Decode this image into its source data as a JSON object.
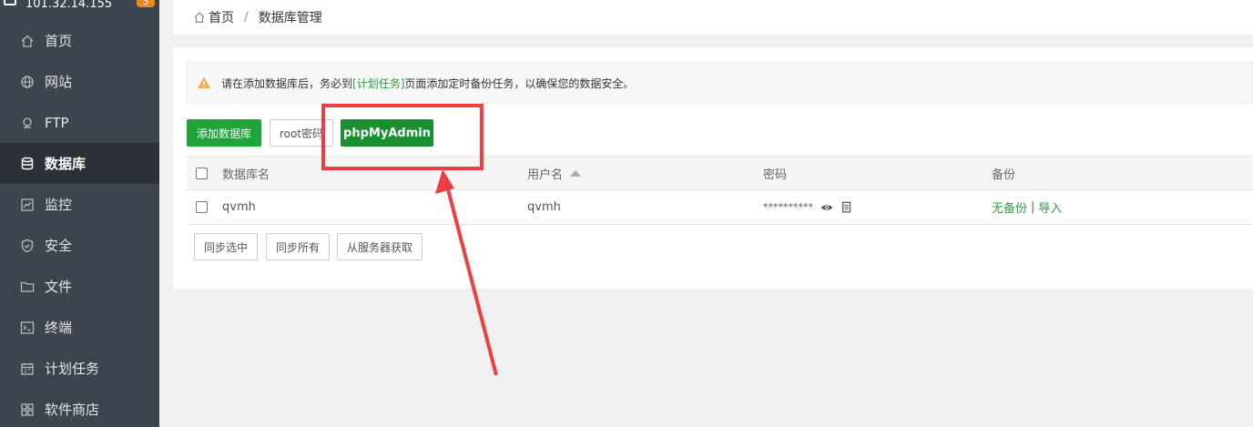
{
  "sidebar": {
    "ip": "101.32.14.155",
    "badge": "3",
    "items": [
      {
        "label": "首页",
        "icon": "home-icon"
      },
      {
        "label": "网站",
        "icon": "globe-icon"
      },
      {
        "label": "FTP",
        "icon": "ftp-icon"
      },
      {
        "label": "数据库",
        "icon": "database-icon"
      },
      {
        "label": "监控",
        "icon": "monitor-icon"
      },
      {
        "label": "安全",
        "icon": "shield-icon"
      },
      {
        "label": "文件",
        "icon": "folder-icon"
      },
      {
        "label": "终端",
        "icon": "terminal-icon"
      },
      {
        "label": "计划任务",
        "icon": "calendar-icon"
      },
      {
        "label": "软件商店",
        "icon": "apps-icon"
      }
    ]
  },
  "breadcrumb": {
    "home": "首页",
    "separator": "/",
    "current": "数据库管理"
  },
  "alert": {
    "prefix": "请在添加数据库后，务必到",
    "link": "[计划任务]",
    "suffix": "页面添加定时备份任务，以确保您的数据安全。"
  },
  "toolbar": {
    "add_db": "添加数据库",
    "root_pw": "root密码",
    "phpmyadmin": "phpMyAdmin"
  },
  "table": {
    "headers": {
      "name": "数据库名",
      "user": "用户名",
      "password": "密码",
      "backup": "备份"
    },
    "rows": [
      {
        "name": "qvmh",
        "user": "qvmh",
        "password": "**********",
        "backup_status": "无备份",
        "backup_sep": "|",
        "import": "导入"
      }
    ]
  },
  "actions": {
    "sync_selected": "同步选中",
    "sync_all": "同步所有",
    "fetch_from_server": "从服务器获取"
  },
  "colors": {
    "sidebar_bg": "#3c444d",
    "accent_green": "#20a53a",
    "annotation_red": "#ef3e42"
  }
}
